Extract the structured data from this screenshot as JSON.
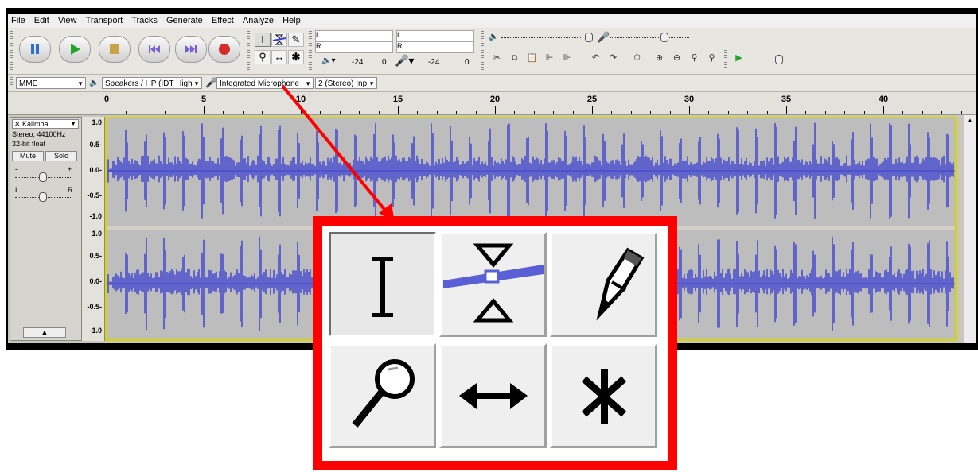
{
  "menu": [
    "File",
    "Edit",
    "View",
    "Transport",
    "Tracks",
    "Generate",
    "Effect",
    "Analyze",
    "Help"
  ],
  "transport": [
    {
      "name": "pause-button",
      "icon": "pause-icon",
      "color": "#2b6fd6"
    },
    {
      "name": "play-button",
      "icon": "play-icon",
      "color": "#1fa62b"
    },
    {
      "name": "stop-button",
      "icon": "stop-icon",
      "color": "#c8a24a"
    },
    {
      "name": "skip-start-button",
      "icon": "skip-start-icon",
      "color": "#7b5fd0"
    },
    {
      "name": "skip-end-button",
      "icon": "skip-end-icon",
      "color": "#7b5fd0"
    },
    {
      "name": "record-button",
      "icon": "record-icon",
      "color": "#d62b2b"
    }
  ],
  "meters": {
    "L": "L",
    "R": "R",
    "scale_left_a": "-24",
    "scale_left_b": "0",
    "scale_right_a": "-24",
    "scale_right_b": "0"
  },
  "devices": {
    "host": "MME",
    "output": "Speakers / HP (IDT High",
    "input": "Integrated Microphone",
    "channels": "2 (Stereo) Inp"
  },
  "ruler": {
    "labels": [
      "0",
      "5",
      "10",
      "15",
      "20",
      "25",
      "30",
      "35",
      "40"
    ]
  },
  "track": {
    "name": "Kalimba",
    "info_line1": "Stereo, 44100Hz",
    "info_line2": "32-bit float",
    "mute": "Mute",
    "solo": "Solo",
    "gain_minus": "-",
    "gain_plus": "+",
    "pan_left": "L",
    "pan_right": "R",
    "collapse": "▲",
    "scale": [
      "1.0",
      "0.5-",
      "0.0-",
      "-0.5-",
      "-1.0",
      "1.0",
      "0.5-",
      "0.0-",
      "-0.5-",
      "-1.0"
    ]
  },
  "colors": {
    "waveform": "#3a3fd0",
    "callout_border": "#ff0000",
    "arrow": "#ff0000",
    "track_border": "#d9d500"
  },
  "callout_tools": [
    {
      "name": "selection-tool",
      "icon": "i-beam-icon",
      "selected": true
    },
    {
      "name": "envelope-tool",
      "icon": "envelope-icon",
      "selected": false
    },
    {
      "name": "draw-tool",
      "icon": "pencil-icon",
      "selected": false
    },
    {
      "name": "zoom-tool",
      "icon": "magnifier-icon",
      "selected": false
    },
    {
      "name": "time-shift-tool",
      "icon": "double-arrow-icon",
      "selected": false
    },
    {
      "name": "multi-tool",
      "icon": "asterisk-icon",
      "selected": false
    }
  ]
}
